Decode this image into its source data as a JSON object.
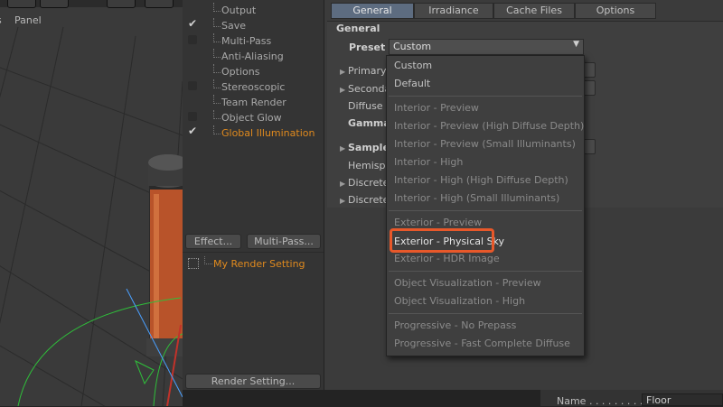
{
  "viewport": {
    "menu_panel": "Panel"
  },
  "tree": {
    "items": [
      {
        "label": "Output",
        "check": "none"
      },
      {
        "label": "Save",
        "check": "tick"
      },
      {
        "label": "Multi-Pass",
        "check": "box"
      },
      {
        "label": "Anti-Aliasing",
        "check": "none"
      },
      {
        "label": "Options",
        "check": "none"
      },
      {
        "label": "Stereoscopic",
        "check": "box"
      },
      {
        "label": "Team Render",
        "check": "none"
      },
      {
        "label": "Object Glow",
        "check": "box"
      },
      {
        "label": "Global Illumination",
        "check": "tick"
      }
    ],
    "effect_button": "Effect...",
    "multipass_button": "Multi-Pass...",
    "render_setting_item": "My Render Setting",
    "render_setting_button": "Render Setting..."
  },
  "tabs": [
    "General",
    "Irradiance Cache",
    "Cache Files",
    "Options"
  ],
  "general": {
    "section_title": "General",
    "preset_label": "Preset",
    "preset_value": "Custom",
    "rows": [
      "Primary M",
      "Secondar",
      "Diffuse D",
      "Gamma",
      "Sample",
      "Hemisphe",
      "Discrete",
      "Discrete"
    ]
  },
  "menu": {
    "group1": [
      "Custom",
      "Default"
    ],
    "group2": [
      "Interior - Preview",
      "Interior - Preview (High Diffuse Depth)",
      "Interior - Preview (Small Illuminants)",
      "Interior - High",
      "Interior - High (High Diffuse Depth)",
      "Interior - High (Small Illuminants)"
    ],
    "group3": [
      "Exterior - Preview",
      "Exterior - Physical Sky",
      "Exterior - HDR Image"
    ],
    "group4": [
      "Object Visualization - Preview",
      "Object Visualization - High"
    ],
    "group5": [
      "Progressive - No Prepass",
      "Progressive - Fast Complete Diffuse"
    ]
  },
  "bottom": {
    "name_label": "Name . . . . . . . . .",
    "name_value": "Floor"
  },
  "colors": {
    "accent": "#e08a1e",
    "highlight_box": "#e8582a",
    "active_tab": "#5d6c80"
  }
}
